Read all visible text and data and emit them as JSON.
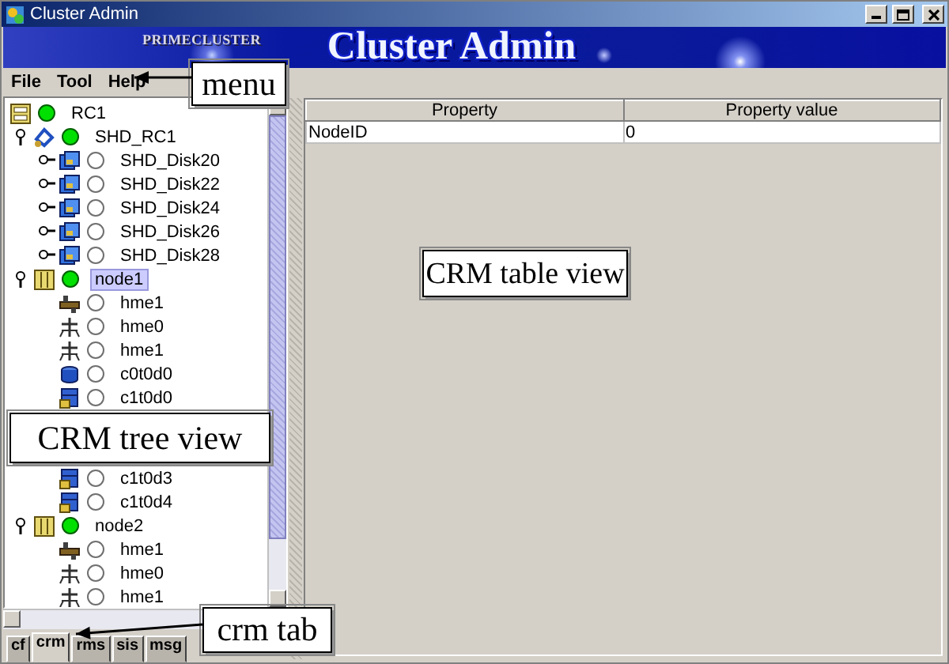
{
  "window": {
    "title": "Cluster Admin"
  },
  "banner": {
    "brand": "PRIMECLUSTER",
    "title": "Cluster Admin"
  },
  "menu": [
    "File",
    "Tool",
    "Help"
  ],
  "tree": [
    {
      "label": "RC1",
      "kind": "cluster",
      "online": true,
      "selected": false,
      "children": [
        {
          "label": "SHD_RC1",
          "kind": "shared",
          "online": true,
          "selected": false,
          "expanded": true,
          "children": [
            {
              "label": "SHD_Disk20",
              "kind": "shared-disk",
              "online": false,
              "selected": false,
              "expanded": false
            },
            {
              "label": "SHD_Disk22",
              "kind": "shared-disk",
              "online": false,
              "selected": false,
              "expanded": false
            },
            {
              "label": "SHD_Disk24",
              "kind": "shared-disk",
              "online": false,
              "selected": false,
              "expanded": false
            },
            {
              "label": "SHD_Disk26",
              "kind": "shared-disk",
              "online": false,
              "selected": false,
              "expanded": false
            },
            {
              "label": "SHD_Disk28",
              "kind": "shared-disk",
              "online": false,
              "selected": false,
              "expanded": false
            }
          ]
        },
        {
          "label": "node1",
          "kind": "node",
          "online": true,
          "selected": true,
          "expanded": true,
          "children": [
            {
              "label": "hme1",
              "kind": "nic",
              "online": false,
              "selected": false
            },
            {
              "label": "hme0",
              "kind": "network",
              "online": false,
              "selected": false
            },
            {
              "label": "hme1",
              "kind": "network",
              "online": false,
              "selected": false
            },
            {
              "label": "c0t0d0",
              "kind": "disk",
              "online": false,
              "selected": false
            },
            {
              "label": "c1t0d0",
              "kind": "storage",
              "online": false,
              "selected": false
            },
            {
              "label": "c1t0d3",
              "kind": "storage",
              "online": false,
              "selected": false,
              "gap_before": true
            },
            {
              "label": "c1t0d4",
              "kind": "storage",
              "online": false,
              "selected": false
            }
          ]
        },
        {
          "label": "node2",
          "kind": "node",
          "online": true,
          "selected": false,
          "expanded": true,
          "children": [
            {
              "label": "hme1",
              "kind": "nic",
              "online": false,
              "selected": false
            },
            {
              "label": "hme0",
              "kind": "network",
              "online": false,
              "selected": false
            },
            {
              "label": "hme1",
              "kind": "network",
              "online": false,
              "selected": false
            }
          ]
        }
      ]
    }
  ],
  "tabs": [
    {
      "label": "cf",
      "selected": false
    },
    {
      "label": "crm",
      "selected": true
    },
    {
      "label": "rms",
      "selected": false
    },
    {
      "label": "sis",
      "selected": false
    },
    {
      "label": "msg",
      "selected": false
    }
  ],
  "table": {
    "columns": [
      "Property",
      "Property value"
    ],
    "rows": [
      [
        "NodeID",
        "0"
      ]
    ]
  },
  "annotations": [
    {
      "text": "menu",
      "kind": "menu",
      "arrow": true
    },
    {
      "text": "CRM tree view",
      "kind": "tree",
      "arrow": false
    },
    {
      "text": "CRM table view",
      "kind": "table",
      "arrow": false
    },
    {
      "text": "crm tab",
      "kind": "tabs",
      "arrow": true
    }
  ]
}
